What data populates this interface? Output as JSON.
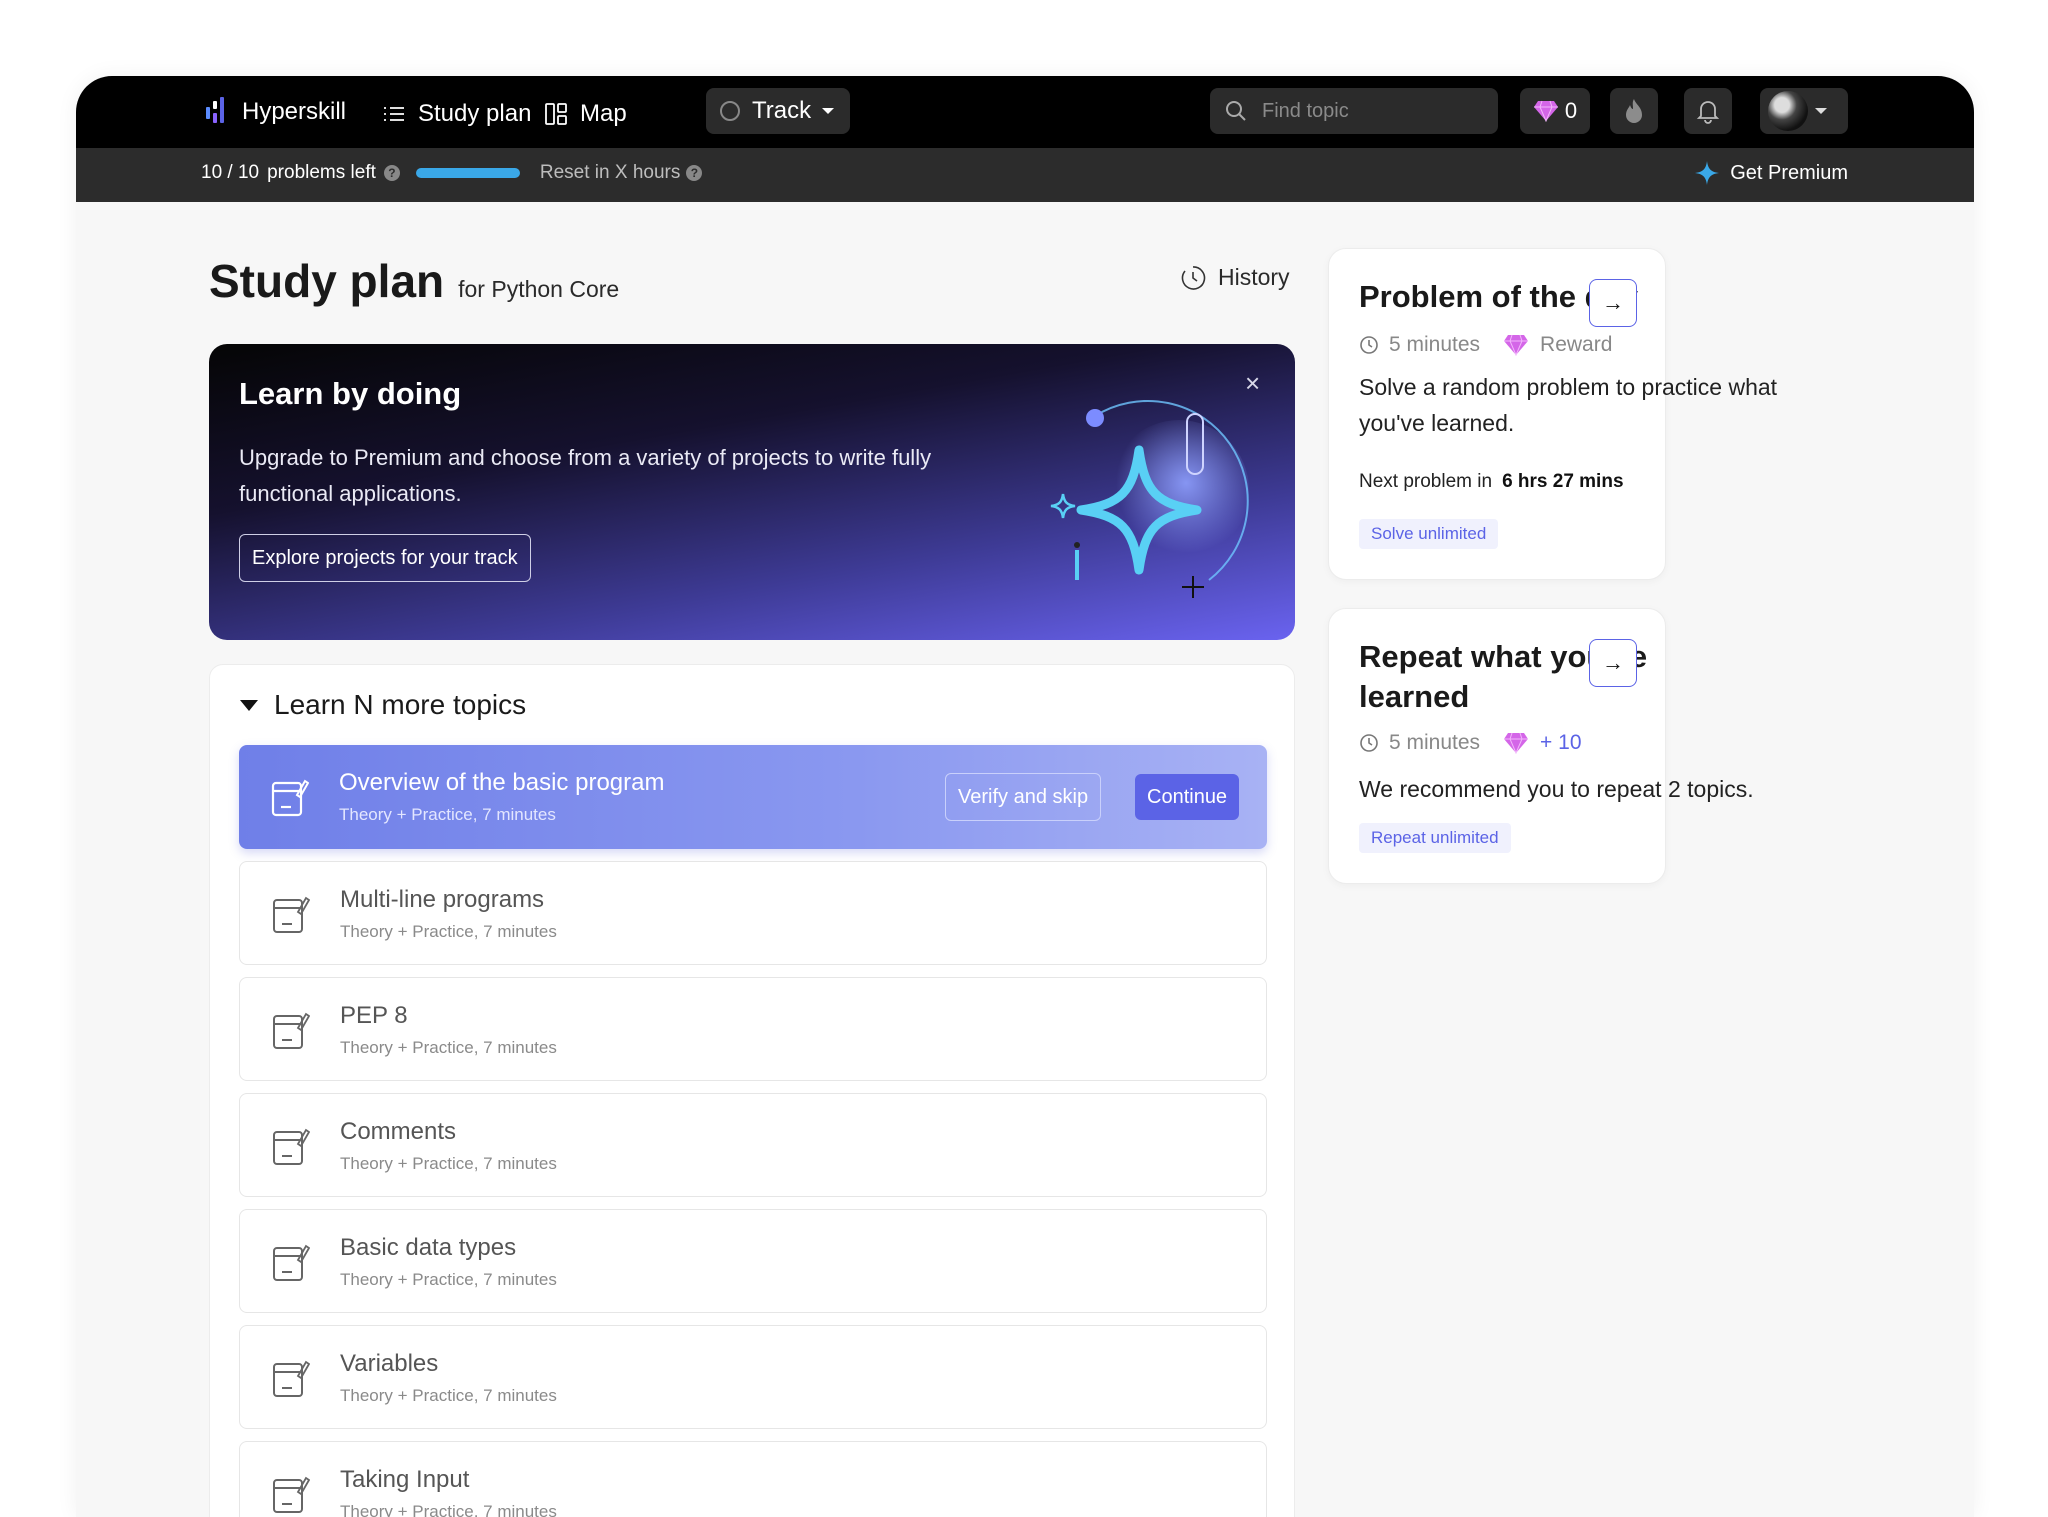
{
  "nav": {
    "brand": "Hyperskill",
    "study_plan": "Study plan",
    "map": "Map",
    "track": "Track",
    "search_placeholder": "Find topic",
    "gems": "0"
  },
  "subbar": {
    "problems": "10 / 10",
    "problems_label": "problems left",
    "reset": "Reset in X hours",
    "premium": "Get Premium"
  },
  "page": {
    "title": "Study plan",
    "subtitle": "for Python Core",
    "history": "History"
  },
  "banner": {
    "title": "Learn by doing",
    "text": "Upgrade to Premium and choose from a variety of projects to write fully functional applications.",
    "button": "Explore projects for your track",
    "close": "×"
  },
  "topics": {
    "header": "Learn N more topics",
    "verify": "Verify and skip",
    "continue": "Continue",
    "items": [
      {
        "name": "Overview of the basic program",
        "meta": "Theory + Practice,  7 minutes"
      },
      {
        "name": "Multi-line programs",
        "meta": "Theory + Practice,  7 minutes"
      },
      {
        "name": "PEP 8",
        "meta": "Theory + Practice,  7 minutes"
      },
      {
        "name": "Comments",
        "meta": "Theory + Practice,  7 minutes"
      },
      {
        "name": "Basic data types",
        "meta": "Theory + Practice,  7 minutes"
      },
      {
        "name": "Variables",
        "meta": "Theory + Practice,  7 minutes"
      },
      {
        "name": "Taking Input",
        "meta": "Theory + Practice,  7 minutes"
      }
    ]
  },
  "problem_card": {
    "title": "Problem of the day",
    "time": "5 minutes",
    "reward": "Reward",
    "text": "Solve a random problem to practice what you've learned.",
    "next_label": "Next problem in",
    "next_value": "6 hrs 27 mins",
    "chip": "Solve unlimited",
    "arrow": "→"
  },
  "repeat_card": {
    "title": "Repeat what you've learned",
    "time": "5 minutes",
    "reward": "+ 10",
    "text": "We recommend you to repeat 2 topics.",
    "chip": "Repeat unlimited",
    "arrow": "→"
  },
  "colors": {
    "accent": "#5b63e6",
    "gem": "#d466e8",
    "progress": "#3aa8e8"
  }
}
